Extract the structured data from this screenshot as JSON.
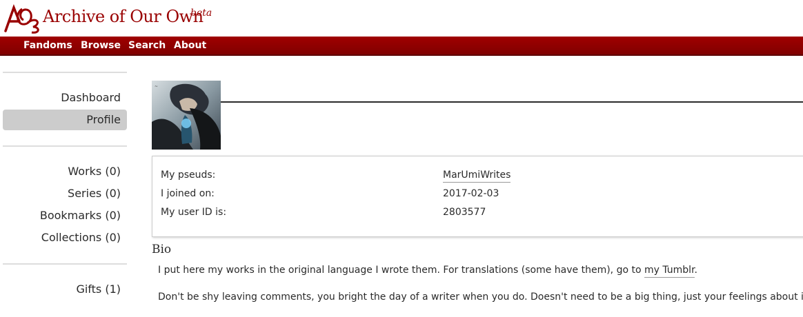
{
  "header": {
    "site_title": "Archive of Our Own",
    "beta_label": "beta",
    "logo_icon": "ao3-logo-icon",
    "brand_color": "#990000"
  },
  "nav": {
    "items": [
      {
        "label": "Fandoms"
      },
      {
        "label": "Browse"
      },
      {
        "label": "Search"
      },
      {
        "label": "About"
      }
    ]
  },
  "sidebar": {
    "group1": [
      {
        "label": "Dashboard",
        "current": false
      },
      {
        "label": "Profile",
        "current": true
      }
    ],
    "group2": [
      {
        "label": "Works (0)"
      },
      {
        "label": "Series (0)"
      },
      {
        "label": "Bookmarks (0)"
      },
      {
        "label": "Collections (0)"
      }
    ],
    "group3": [
      {
        "label": "Gifts (1)"
      }
    ]
  },
  "profile": {
    "avatar_icon": "user-avatar-image",
    "meta": [
      {
        "label": "My pseuds:",
        "value": "MarUmiWrites",
        "is_link": true
      },
      {
        "label": "I joined on:",
        "value": "2017-02-03",
        "is_link": false
      },
      {
        "label": "My user ID is:",
        "value": "2803577",
        "is_link": false
      }
    ],
    "bio_title": "Bio",
    "bio_p1_text": "I put here my works in the original language I wrote them. For translations (some have them), go to ",
    "bio_p1_link": "my Tumblr",
    "bio_p1_end": ".",
    "bio_p2": "Don't be shy leaving comments, you bright the day of a writer when you do. Doesn't need to be a big thing, just your feelings about it."
  }
}
